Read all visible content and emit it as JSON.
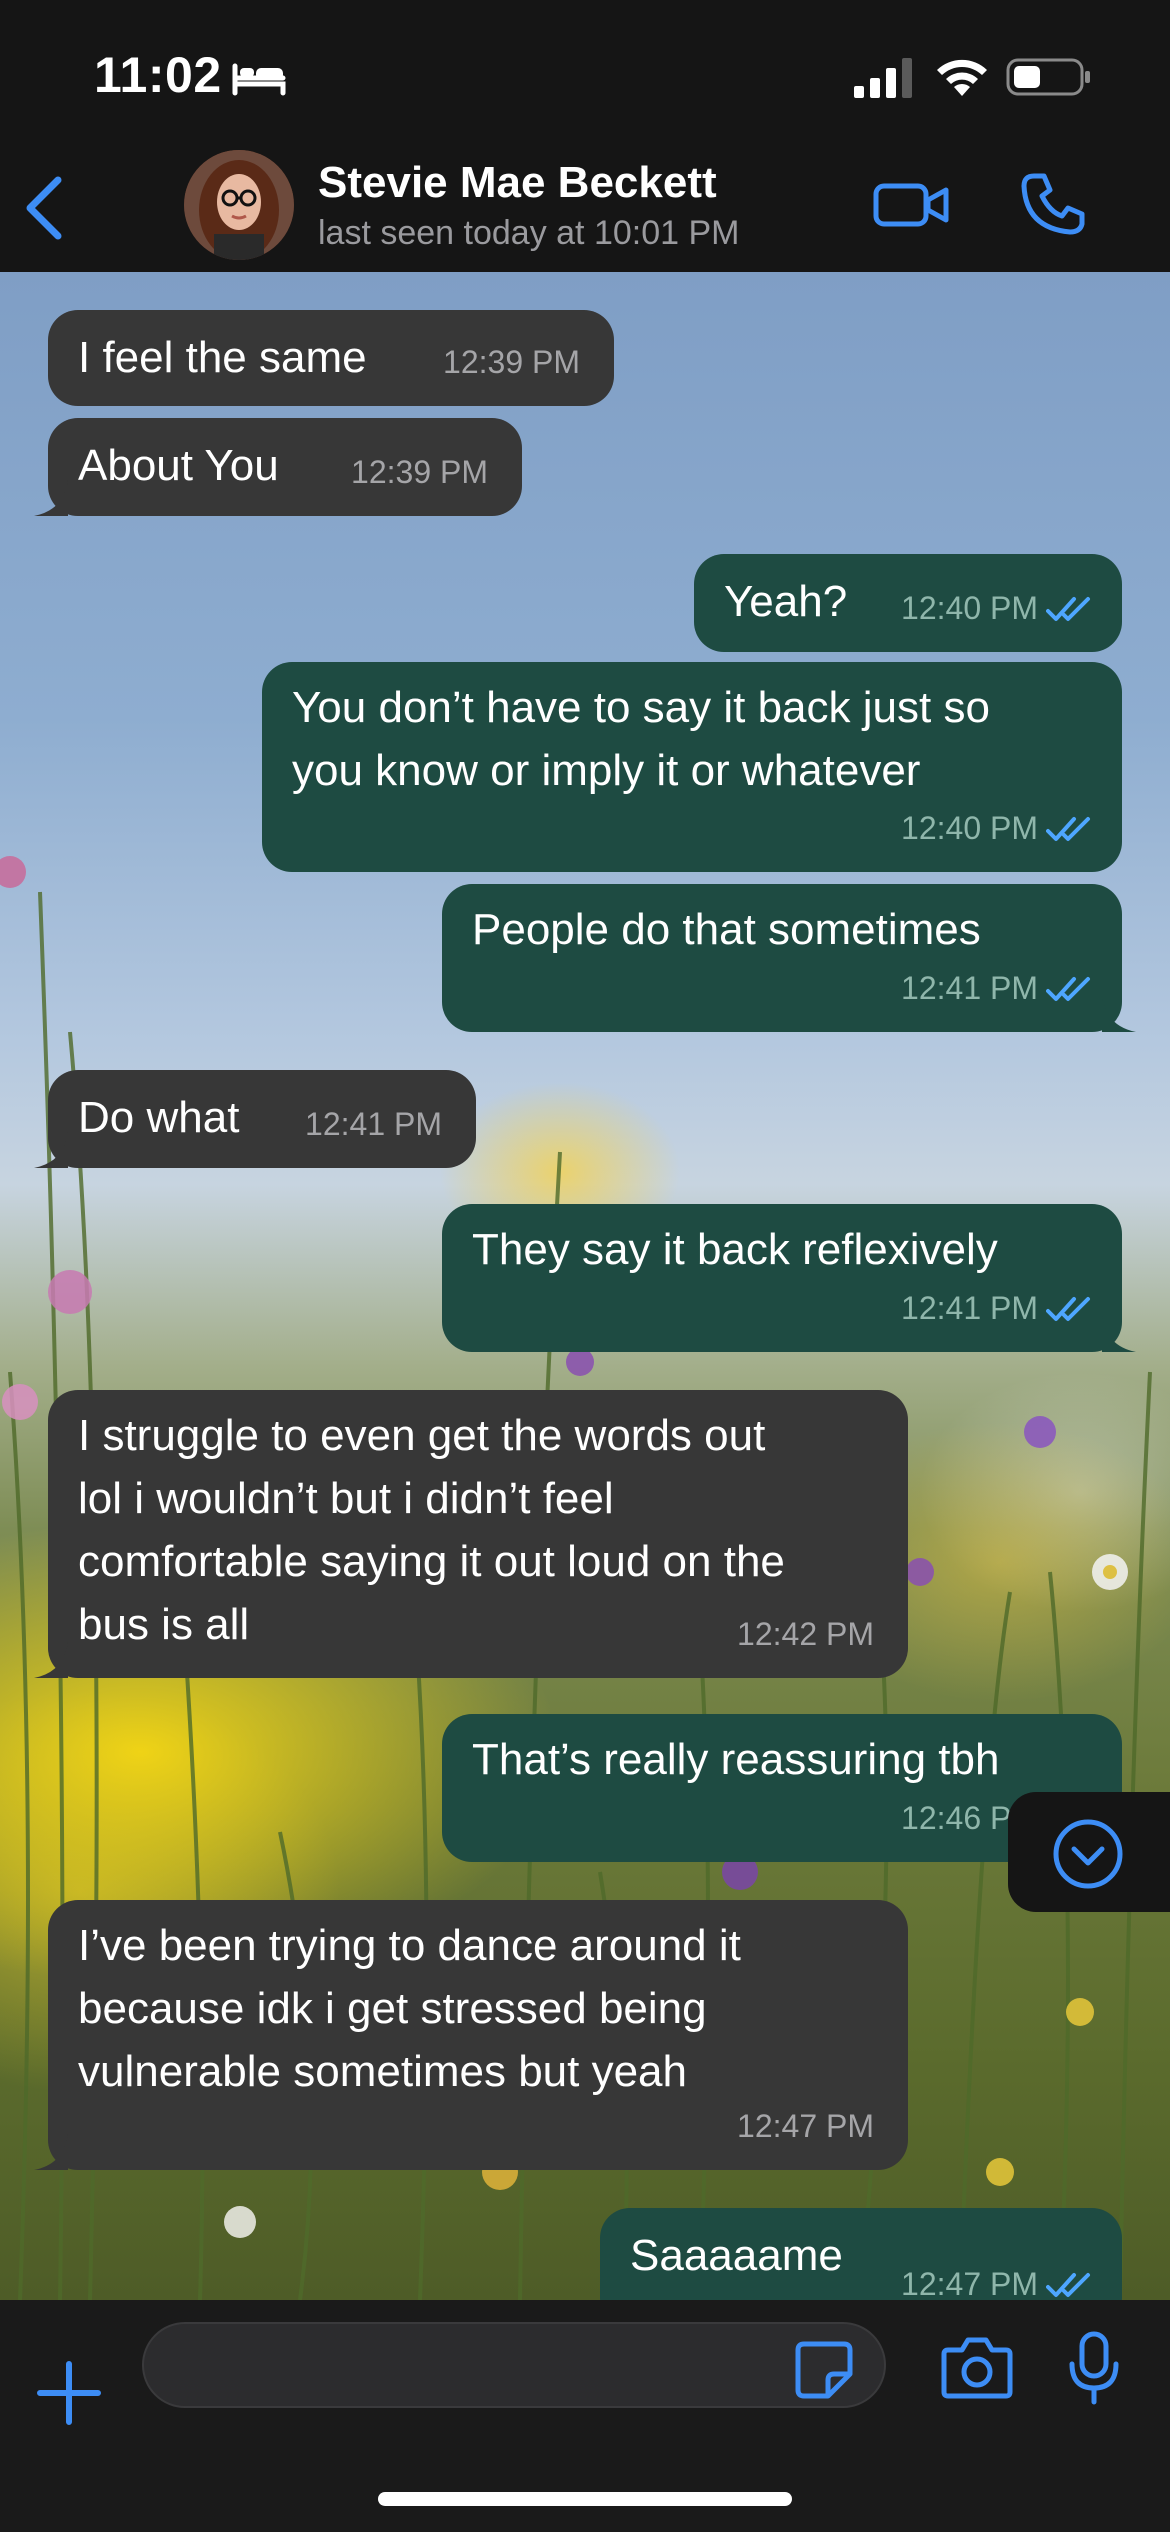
{
  "status_bar": {
    "time": "11:02",
    "focus_icon": "bed-icon",
    "signal_icon": "cellular-signal-icon",
    "wifi_icon": "wifi-icon",
    "battery_icon": "battery-icon"
  },
  "header": {
    "back_icon": "chevron-left-icon",
    "contact_name": "Stevie Mae Beckett",
    "last_seen": "last seen today at 10:01 PM",
    "video_call_icon": "video-camera-icon",
    "voice_call_icon": "phone-icon"
  },
  "messages": [
    {
      "direction": "in",
      "text": "I feel the same",
      "time": "12:39 PM"
    },
    {
      "direction": "in",
      "text": "About You",
      "time": "12:39 PM"
    },
    {
      "direction": "out",
      "text": "Yeah?",
      "time": "12:40 PM",
      "status": "read"
    },
    {
      "direction": "out",
      "text": "You don’t have to say it back just so\nyou know or imply it or whatever",
      "time": "12:40 PM",
      "status": "read"
    },
    {
      "direction": "out",
      "text": "People do that sometimes",
      "time": "12:41 PM",
      "status": "read"
    },
    {
      "direction": "in",
      "text": "Do what",
      "time": "12:41 PM"
    },
    {
      "direction": "out",
      "text": "They say it back reflexively",
      "time": "12:41 PM",
      "status": "read"
    },
    {
      "direction": "in",
      "text": "I struggle to even get the words out\nlol i wouldn’t but i didn’t feel\ncomfortable saying it out loud on the\nbus is all",
      "time": "12:42 PM"
    },
    {
      "direction": "out",
      "text": "That’s really reassuring tbh",
      "time": "12:46 PM",
      "status": "read"
    },
    {
      "direction": "in",
      "text": "I’ve been trying to dance around it\nbecause idk i get stressed being\nvulnerable sometimes but yeah",
      "time": "12:47 PM"
    },
    {
      "direction": "out",
      "text": "Saaaaame",
      "time": "12:47 PM",
      "status": "read"
    }
  ],
  "scroll_down_icon": "chevron-down-circle-icon",
  "composer": {
    "attach_icon": "plus-icon",
    "message_value": "",
    "sticker_icon": "sticker-icon",
    "camera_icon": "camera-icon",
    "mic_icon": "microphone-icon"
  },
  "colors": {
    "accent": "#3d8df5",
    "incoming_bubble": "#373737",
    "outgoing_bubble": "#1e4b42",
    "read_ticks": "#4ea6ff"
  }
}
